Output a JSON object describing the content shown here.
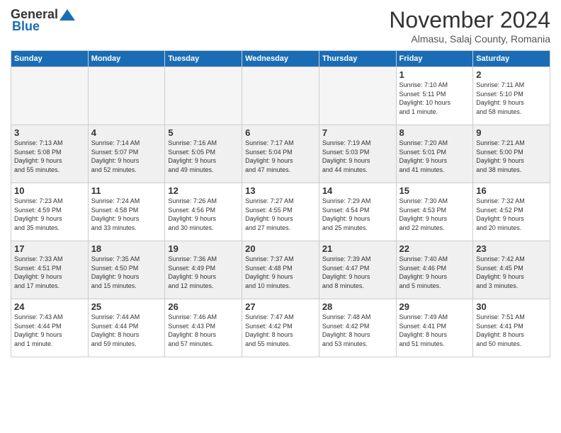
{
  "header": {
    "logo": {
      "general": "General",
      "blue": "Blue"
    },
    "title": "November 2024",
    "location": "Almasu, Salaj County, Romania"
  },
  "weekdays": [
    "Sunday",
    "Monday",
    "Tuesday",
    "Wednesday",
    "Thursday",
    "Friday",
    "Saturday"
  ],
  "weeks": [
    [
      {
        "day": "",
        "info": ""
      },
      {
        "day": "",
        "info": ""
      },
      {
        "day": "",
        "info": ""
      },
      {
        "day": "",
        "info": ""
      },
      {
        "day": "",
        "info": ""
      },
      {
        "day": "1",
        "info": "Sunrise: 7:10 AM\nSunset: 5:11 PM\nDaylight: 10 hours\nand 1 minute."
      },
      {
        "day": "2",
        "info": "Sunrise: 7:11 AM\nSunset: 5:10 PM\nDaylight: 9 hours\nand 58 minutes."
      }
    ],
    [
      {
        "day": "3",
        "info": "Sunrise: 7:13 AM\nSunset: 5:08 PM\nDaylight: 9 hours\nand 55 minutes."
      },
      {
        "day": "4",
        "info": "Sunrise: 7:14 AM\nSunset: 5:07 PM\nDaylight: 9 hours\nand 52 minutes."
      },
      {
        "day": "5",
        "info": "Sunrise: 7:16 AM\nSunset: 5:05 PM\nDaylight: 9 hours\nand 49 minutes."
      },
      {
        "day": "6",
        "info": "Sunrise: 7:17 AM\nSunset: 5:04 PM\nDaylight: 9 hours\nand 47 minutes."
      },
      {
        "day": "7",
        "info": "Sunrise: 7:19 AM\nSunset: 5:03 PM\nDaylight: 9 hours\nand 44 minutes."
      },
      {
        "day": "8",
        "info": "Sunrise: 7:20 AM\nSunset: 5:01 PM\nDaylight: 9 hours\nand 41 minutes."
      },
      {
        "day": "9",
        "info": "Sunrise: 7:21 AM\nSunset: 5:00 PM\nDaylight: 9 hours\nand 38 minutes."
      }
    ],
    [
      {
        "day": "10",
        "info": "Sunrise: 7:23 AM\nSunset: 4:59 PM\nDaylight: 9 hours\nand 35 minutes."
      },
      {
        "day": "11",
        "info": "Sunrise: 7:24 AM\nSunset: 4:58 PM\nDaylight: 9 hours\nand 33 minutes."
      },
      {
        "day": "12",
        "info": "Sunrise: 7:26 AM\nSunset: 4:56 PM\nDaylight: 9 hours\nand 30 minutes."
      },
      {
        "day": "13",
        "info": "Sunrise: 7:27 AM\nSunset: 4:55 PM\nDaylight: 9 hours\nand 27 minutes."
      },
      {
        "day": "14",
        "info": "Sunrise: 7:29 AM\nSunset: 4:54 PM\nDaylight: 9 hours\nand 25 minutes."
      },
      {
        "day": "15",
        "info": "Sunrise: 7:30 AM\nSunset: 4:53 PM\nDaylight: 9 hours\nand 22 minutes."
      },
      {
        "day": "16",
        "info": "Sunrise: 7:32 AM\nSunset: 4:52 PM\nDaylight: 9 hours\nand 20 minutes."
      }
    ],
    [
      {
        "day": "17",
        "info": "Sunrise: 7:33 AM\nSunset: 4:51 PM\nDaylight: 9 hours\nand 17 minutes."
      },
      {
        "day": "18",
        "info": "Sunrise: 7:35 AM\nSunset: 4:50 PM\nDaylight: 9 hours\nand 15 minutes."
      },
      {
        "day": "19",
        "info": "Sunrise: 7:36 AM\nSunset: 4:49 PM\nDaylight: 9 hours\nand 12 minutes."
      },
      {
        "day": "20",
        "info": "Sunrise: 7:37 AM\nSunset: 4:48 PM\nDaylight: 9 hours\nand 10 minutes."
      },
      {
        "day": "21",
        "info": "Sunrise: 7:39 AM\nSunset: 4:47 PM\nDaylight: 9 hours\nand 8 minutes."
      },
      {
        "day": "22",
        "info": "Sunrise: 7:40 AM\nSunset: 4:46 PM\nDaylight: 9 hours\nand 5 minutes."
      },
      {
        "day": "23",
        "info": "Sunrise: 7:42 AM\nSunset: 4:45 PM\nDaylight: 9 hours\nand 3 minutes."
      }
    ],
    [
      {
        "day": "24",
        "info": "Sunrise: 7:43 AM\nSunset: 4:44 PM\nDaylight: 9 hours\nand 1 minute."
      },
      {
        "day": "25",
        "info": "Sunrise: 7:44 AM\nSunset: 4:44 PM\nDaylight: 8 hours\nand 59 minutes."
      },
      {
        "day": "26",
        "info": "Sunrise: 7:46 AM\nSunset: 4:43 PM\nDaylight: 8 hours\nand 57 minutes."
      },
      {
        "day": "27",
        "info": "Sunrise: 7:47 AM\nSunset: 4:42 PM\nDaylight: 8 hours\nand 55 minutes."
      },
      {
        "day": "28",
        "info": "Sunrise: 7:48 AM\nSunset: 4:42 PM\nDaylight: 8 hours\nand 53 minutes."
      },
      {
        "day": "29",
        "info": "Sunrise: 7:49 AM\nSunset: 4:41 PM\nDaylight: 8 hours\nand 51 minutes."
      },
      {
        "day": "30",
        "info": "Sunrise: 7:51 AM\nSunset: 4:41 PM\nDaylight: 8 hours\nand 50 minutes."
      }
    ]
  ]
}
